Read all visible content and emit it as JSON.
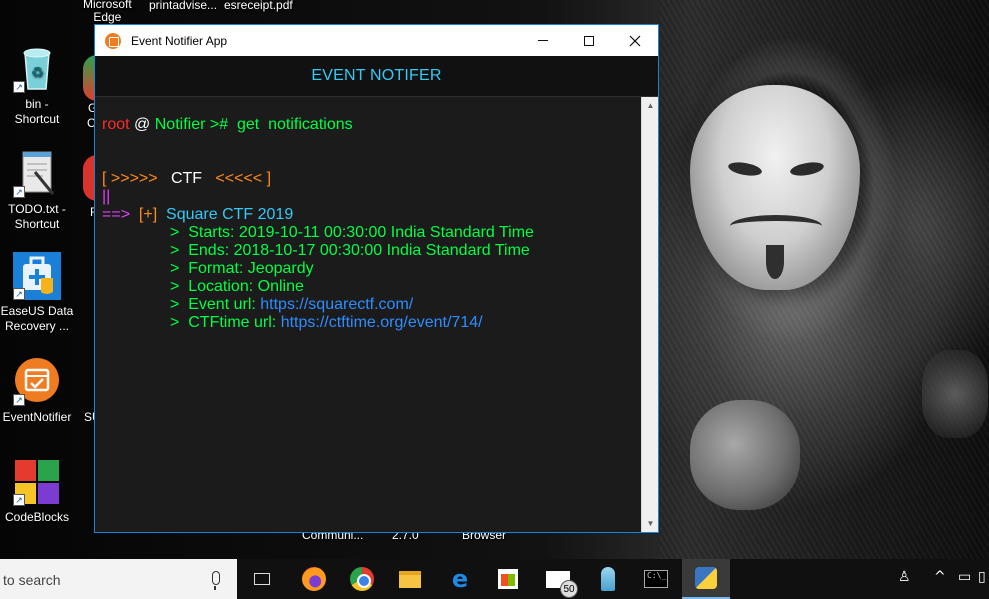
{
  "desktop": {
    "top_labels": [
      "Microsoft\nEdge",
      "printadvise...",
      "esreceipt.pdf"
    ],
    "icons": [
      {
        "label": "bin -\nShortcut",
        "icon": "recycle-bin-icon"
      },
      {
        "label": "TODO.txt -\nShortcut",
        "icon": "notepad-icon"
      },
      {
        "label": "EaseUS Data\nRecovery ...",
        "icon": "easeus-icon"
      },
      {
        "label": "EventNotifier",
        "icon": "event-notifier-icon"
      },
      {
        "label": "CodeBlocks",
        "icon": "codeblocks-icon"
      }
    ],
    "partial_labels": [
      "G",
      "C",
      "F",
      "SU",
      "Communi...",
      "2.7.0",
      "Browser"
    ]
  },
  "window": {
    "title": "Event Notifier App",
    "controls": {
      "minimize": "minimize",
      "maximize": "maximize",
      "close": "close"
    },
    "header": "EVENT NOTIFER"
  },
  "terminal": {
    "prompt_user": "root",
    "prompt_at": "@",
    "prompt_host": "Notifier >#",
    "command": "get  notifications",
    "section_open": "[ >>>>>",
    "section_name": "CTF",
    "section_close": "<<<<< ]",
    "pipe": "||",
    "arrow": "==>",
    "marker": "[+]",
    "event_name": "Square CTF 2019",
    "details": [
      {
        "label": ">  Starts: ",
        "value": "2019-10-11 00:30:00 India Standard Time",
        "link": false
      },
      {
        "label": ">  Ends: ",
        "value": "2018-10-17 00:30:00 India Standard Time",
        "link": false
      },
      {
        "label": ">  Format: ",
        "value": "Jeopardy",
        "link": false
      },
      {
        "label": ">  Location: ",
        "value": "Online",
        "link": false
      },
      {
        "label": ">  Event url: ",
        "value": "https://squarectf.com/",
        "link": true
      },
      {
        "label": ">  CTFtime url: ",
        "value": "https://ctftime.org/event/714/",
        "link": true
      }
    ]
  },
  "taskbar": {
    "search_placeholder": "to search",
    "mail_badge": "50",
    "apps": [
      "task-view",
      "firefox",
      "chrome",
      "file-explorer",
      "edge",
      "store",
      "mail",
      "figure",
      "cmd",
      "python"
    ]
  },
  "colors": {
    "accent": "#35c9f5",
    "prompt_red": "#ff2a2a",
    "terminal_green": "#00ff44",
    "bracket_orange": "#ff8a1e",
    "link_blue": "#2f8cff",
    "window_border": "#1883d7"
  }
}
